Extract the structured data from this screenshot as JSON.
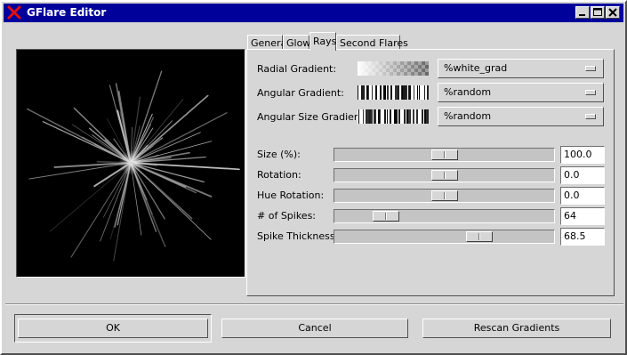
{
  "window": {
    "title": "GFlare Editor"
  },
  "titlebar": {
    "buttons": [
      "minimize-icon",
      "maximize-icon",
      "close-icon"
    ]
  },
  "tabs": [
    {
      "label": "General",
      "active": false
    },
    {
      "label": "Glow",
      "active": false
    },
    {
      "label": "Rays",
      "active": true
    },
    {
      "label": "Second Flares",
      "active": false
    }
  ],
  "gradients": [
    {
      "label": "Radial Gradient:",
      "value": "%white_grad"
    },
    {
      "label": "Angular Gradient:",
      "value": "%random"
    },
    {
      "label": "Angular Size Gradient:",
      "value": "%random"
    }
  ],
  "sliders": [
    {
      "label": "Size (%):",
      "value": "100.0",
      "position": 0.5
    },
    {
      "label": "Rotation:",
      "value": "0.0",
      "position": 0.5
    },
    {
      "label": "Hue Rotation:",
      "value": "0.0",
      "position": 0.5
    },
    {
      "label": "# of Spikes:",
      "value": "64",
      "position": 0.2
    },
    {
      "label": "Spike Thickness:",
      "value": "68.5",
      "position": 0.68
    }
  ],
  "buttons": {
    "ok": "OK",
    "cancel": "Cancel",
    "rescan": "Rescan Gradients"
  },
  "colors": {
    "titlebar": "#00009a",
    "background": "#d6d6d6",
    "preview_bg": "#000000"
  }
}
